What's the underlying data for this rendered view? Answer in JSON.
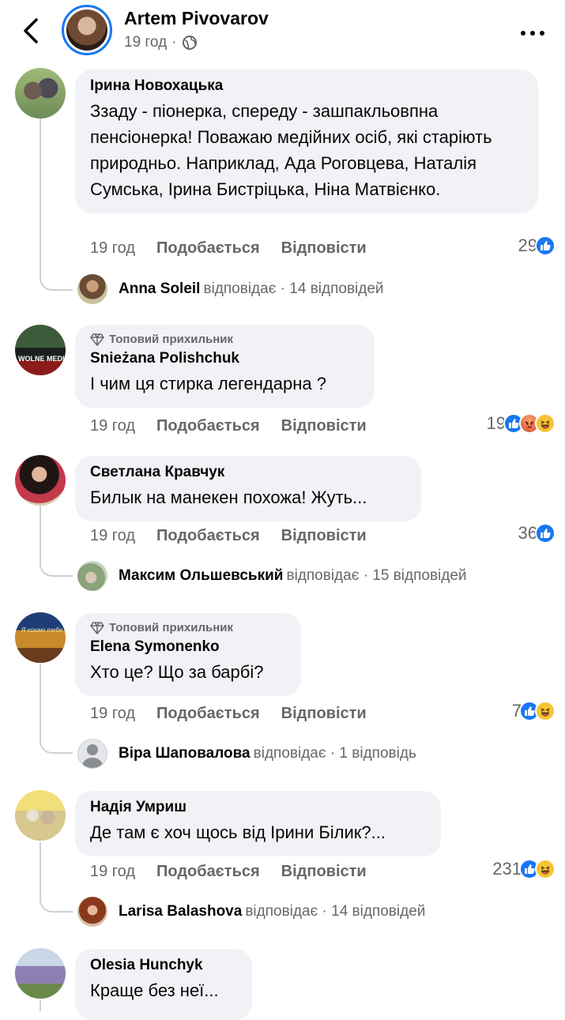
{
  "header": {
    "page_name": "Artem Pivovarov",
    "time": "19 год",
    "separator": "·",
    "globe_icon": "globe-icon"
  },
  "labels": {
    "like": "Подобається",
    "reply": "Відповісти"
  },
  "comments": [
    {
      "author": "Ірина Новохацька",
      "text": "Ззаду - піонерка, спереду - зашпакльовпна пенсіонерка! Поважаю медійних осіб, які старіють природньо. Наприклад, Ада Роговцева, Наталія Сумська, Ірина Бистріцька, Ніна Матвієнко.",
      "time": "19 год",
      "count": "29",
      "reply": {
        "name": "Anna Soleil",
        "verb": "відповідає",
        "count": "· 14 відповідей"
      }
    },
    {
      "badge": "Топовий прихильник",
      "author": "Snieżana Polishchuk",
      "text": "І чим ця стирка легендарна ?",
      "time": "19 год",
      "count": "19"
    },
    {
      "author": "Светлана Кравчук",
      "text": "Билык на манекен похожа! Жуть...",
      "time": "19 год",
      "count": "36",
      "reply": {
        "name": "Максим Ольшевський",
        "verb": "відповідає",
        "count": "· 15 відповідей"
      }
    },
    {
      "badge": "Топовий прихильник",
      "author": "Elena Symonenko",
      "text": "Хто це? Що за барбі?",
      "time": "19 год",
      "count": "7",
      "reply": {
        "name": "Віра Шаповалова",
        "verb": "відповідає",
        "count": "· 1 відповідь"
      }
    },
    {
      "author": "Надія Умриш",
      "text": "Де там є хоч щось від Ірини Білик?...",
      "time": "19 год",
      "count": "231",
      "reply": {
        "name": "Larisa Balashova",
        "verb": "відповідає",
        "count": "· 14 відповідей"
      }
    },
    {
      "author": "Olesia Hunchyk",
      "text": "Краще без неї..."
    }
  ]
}
